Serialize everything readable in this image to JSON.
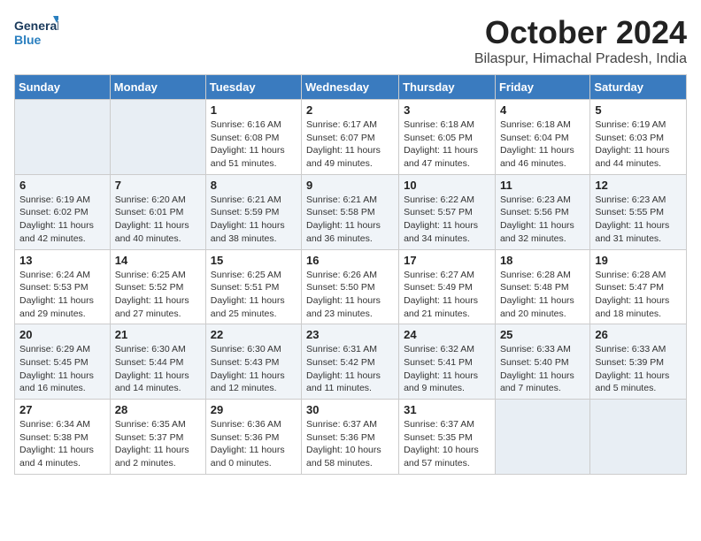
{
  "logo": {
    "general": "General",
    "blue": "Blue"
  },
  "title": {
    "month": "October 2024",
    "location": "Bilaspur, Himachal Pradesh, India"
  },
  "headers": [
    "Sunday",
    "Monday",
    "Tuesday",
    "Wednesday",
    "Thursday",
    "Friday",
    "Saturday"
  ],
  "weeks": [
    [
      {
        "num": "",
        "detail": ""
      },
      {
        "num": "",
        "detail": ""
      },
      {
        "num": "1",
        "detail": "Sunrise: 6:16 AM\nSunset: 6:08 PM\nDaylight: 11 hours and 51 minutes."
      },
      {
        "num": "2",
        "detail": "Sunrise: 6:17 AM\nSunset: 6:07 PM\nDaylight: 11 hours and 49 minutes."
      },
      {
        "num": "3",
        "detail": "Sunrise: 6:18 AM\nSunset: 6:05 PM\nDaylight: 11 hours and 47 minutes."
      },
      {
        "num": "4",
        "detail": "Sunrise: 6:18 AM\nSunset: 6:04 PM\nDaylight: 11 hours and 46 minutes."
      },
      {
        "num": "5",
        "detail": "Sunrise: 6:19 AM\nSunset: 6:03 PM\nDaylight: 11 hours and 44 minutes."
      }
    ],
    [
      {
        "num": "6",
        "detail": "Sunrise: 6:19 AM\nSunset: 6:02 PM\nDaylight: 11 hours and 42 minutes."
      },
      {
        "num": "7",
        "detail": "Sunrise: 6:20 AM\nSunset: 6:01 PM\nDaylight: 11 hours and 40 minutes."
      },
      {
        "num": "8",
        "detail": "Sunrise: 6:21 AM\nSunset: 5:59 PM\nDaylight: 11 hours and 38 minutes."
      },
      {
        "num": "9",
        "detail": "Sunrise: 6:21 AM\nSunset: 5:58 PM\nDaylight: 11 hours and 36 minutes."
      },
      {
        "num": "10",
        "detail": "Sunrise: 6:22 AM\nSunset: 5:57 PM\nDaylight: 11 hours and 34 minutes."
      },
      {
        "num": "11",
        "detail": "Sunrise: 6:23 AM\nSunset: 5:56 PM\nDaylight: 11 hours and 32 minutes."
      },
      {
        "num": "12",
        "detail": "Sunrise: 6:23 AM\nSunset: 5:55 PM\nDaylight: 11 hours and 31 minutes."
      }
    ],
    [
      {
        "num": "13",
        "detail": "Sunrise: 6:24 AM\nSunset: 5:53 PM\nDaylight: 11 hours and 29 minutes."
      },
      {
        "num": "14",
        "detail": "Sunrise: 6:25 AM\nSunset: 5:52 PM\nDaylight: 11 hours and 27 minutes."
      },
      {
        "num": "15",
        "detail": "Sunrise: 6:25 AM\nSunset: 5:51 PM\nDaylight: 11 hours and 25 minutes."
      },
      {
        "num": "16",
        "detail": "Sunrise: 6:26 AM\nSunset: 5:50 PM\nDaylight: 11 hours and 23 minutes."
      },
      {
        "num": "17",
        "detail": "Sunrise: 6:27 AM\nSunset: 5:49 PM\nDaylight: 11 hours and 21 minutes."
      },
      {
        "num": "18",
        "detail": "Sunrise: 6:28 AM\nSunset: 5:48 PM\nDaylight: 11 hours and 20 minutes."
      },
      {
        "num": "19",
        "detail": "Sunrise: 6:28 AM\nSunset: 5:47 PM\nDaylight: 11 hours and 18 minutes."
      }
    ],
    [
      {
        "num": "20",
        "detail": "Sunrise: 6:29 AM\nSunset: 5:45 PM\nDaylight: 11 hours and 16 minutes."
      },
      {
        "num": "21",
        "detail": "Sunrise: 6:30 AM\nSunset: 5:44 PM\nDaylight: 11 hours and 14 minutes."
      },
      {
        "num": "22",
        "detail": "Sunrise: 6:30 AM\nSunset: 5:43 PM\nDaylight: 11 hours and 12 minutes."
      },
      {
        "num": "23",
        "detail": "Sunrise: 6:31 AM\nSunset: 5:42 PM\nDaylight: 11 hours and 11 minutes."
      },
      {
        "num": "24",
        "detail": "Sunrise: 6:32 AM\nSunset: 5:41 PM\nDaylight: 11 hours and 9 minutes."
      },
      {
        "num": "25",
        "detail": "Sunrise: 6:33 AM\nSunset: 5:40 PM\nDaylight: 11 hours and 7 minutes."
      },
      {
        "num": "26",
        "detail": "Sunrise: 6:33 AM\nSunset: 5:39 PM\nDaylight: 11 hours and 5 minutes."
      }
    ],
    [
      {
        "num": "27",
        "detail": "Sunrise: 6:34 AM\nSunset: 5:38 PM\nDaylight: 11 hours and 4 minutes."
      },
      {
        "num": "28",
        "detail": "Sunrise: 6:35 AM\nSunset: 5:37 PM\nDaylight: 11 hours and 2 minutes."
      },
      {
        "num": "29",
        "detail": "Sunrise: 6:36 AM\nSunset: 5:36 PM\nDaylight: 11 hours and 0 minutes."
      },
      {
        "num": "30",
        "detail": "Sunrise: 6:37 AM\nSunset: 5:36 PM\nDaylight: 10 hours and 58 minutes."
      },
      {
        "num": "31",
        "detail": "Sunrise: 6:37 AM\nSunset: 5:35 PM\nDaylight: 10 hours and 57 minutes."
      },
      {
        "num": "",
        "detail": ""
      },
      {
        "num": "",
        "detail": ""
      }
    ]
  ]
}
